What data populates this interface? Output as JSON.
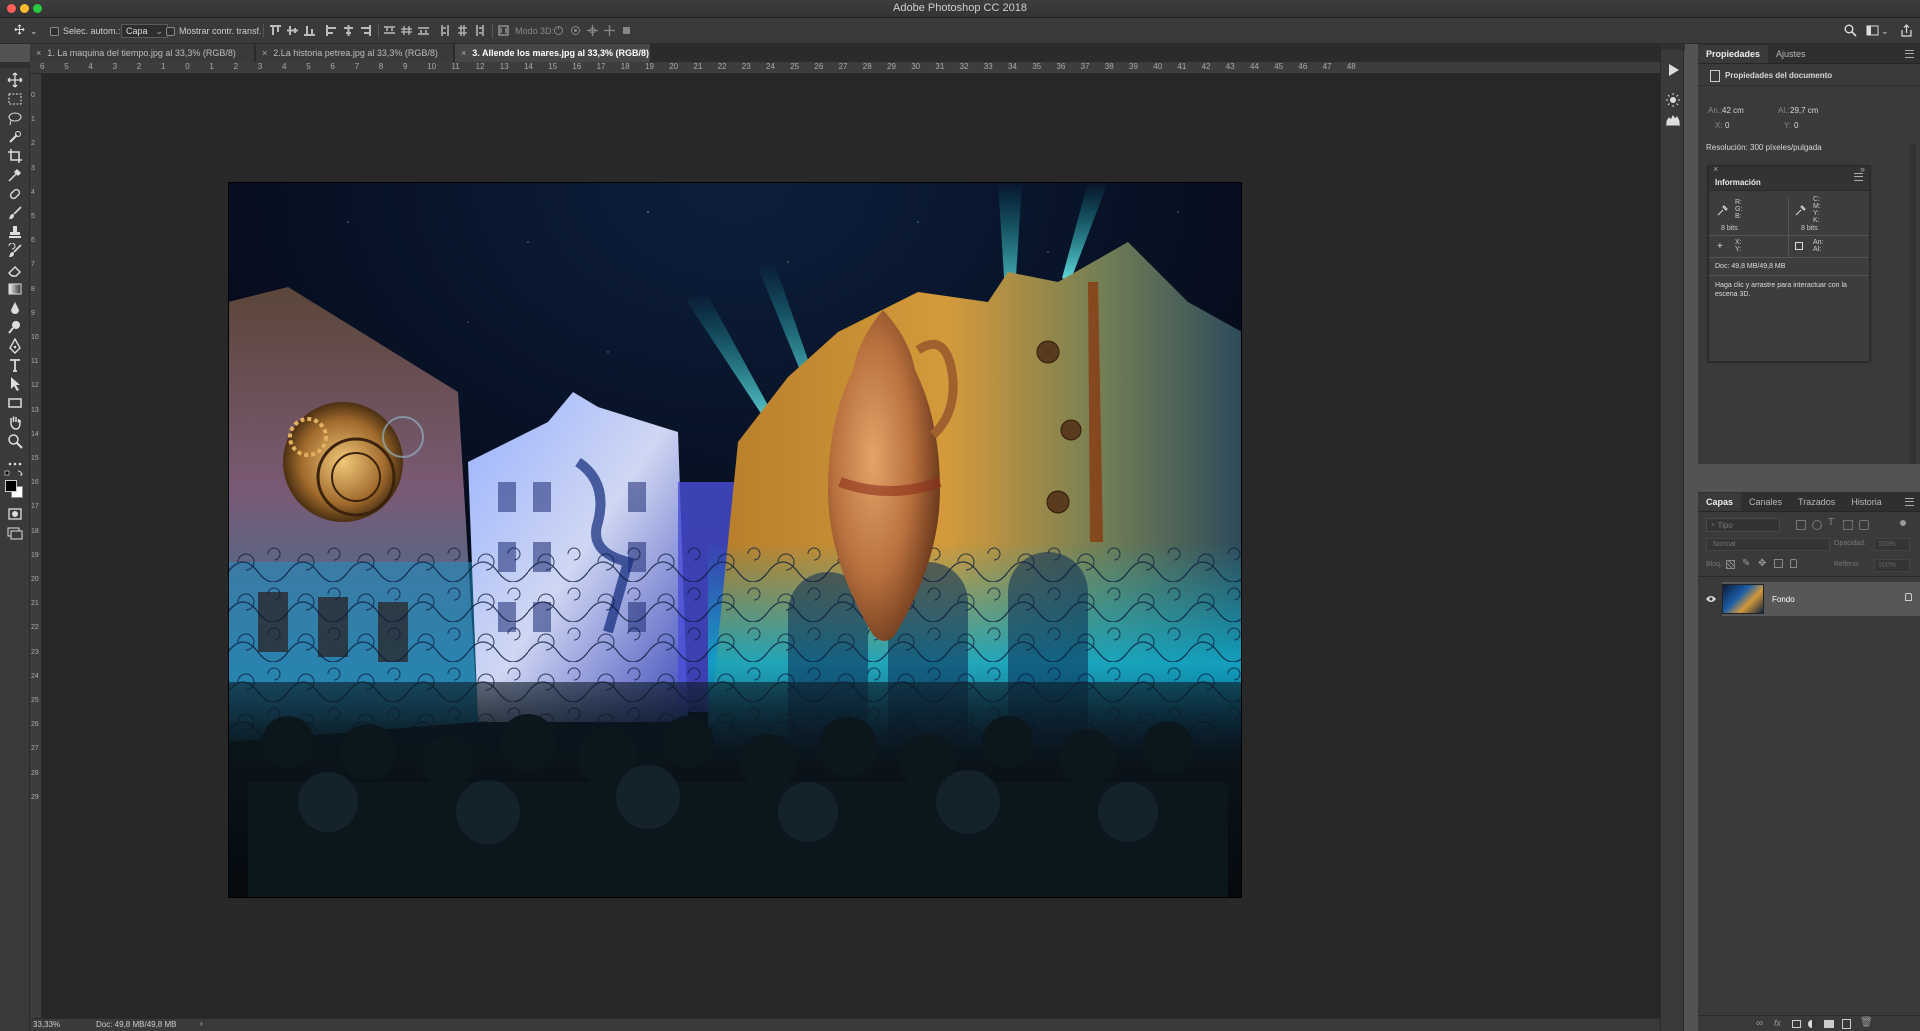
{
  "app": {
    "window_title": "Adobe Photoshop CC 2018"
  },
  "options_bar": {
    "auto_select_label": "Selec. autom.:",
    "auto_select_target": "Capa",
    "show_transform_label": "Mostrar contr. transf.",
    "mode_3d_label": "Modo 3D:"
  },
  "tabs": [
    {
      "label": "1. La maquina del tiempo.jpg al 33,3% (RGB/8)",
      "active": false
    },
    {
      "label": "2.La historia petrea.jpg al 33,3% (RGB/8)",
      "active": false
    },
    {
      "label": "3. Allende los mares.jpg al 33,3% (RGB/8)",
      "active": true
    }
  ],
  "ruler_top": [
    "6",
    "5",
    "4",
    "3",
    "2",
    "1",
    "0",
    "1",
    "2",
    "3",
    "4",
    "5",
    "6",
    "7",
    "8",
    "9",
    "10",
    "11",
    "12",
    "13",
    "14",
    "15",
    "16",
    "17",
    "18",
    "19",
    "20",
    "21",
    "22",
    "23",
    "24",
    "25",
    "26",
    "27",
    "28",
    "29",
    "30",
    "31",
    "32",
    "33",
    "34",
    "35",
    "36",
    "37",
    "38",
    "39",
    "40",
    "41",
    "42",
    "43",
    "44",
    "45",
    "46",
    "47",
    "48"
  ],
  "ruler_left": [
    "0",
    "1",
    "2",
    "3",
    "4",
    "5",
    "6",
    "7",
    "8",
    "9",
    "10",
    "11",
    "12",
    "13",
    "14",
    "15",
    "16",
    "17",
    "18",
    "19",
    "20",
    "21",
    "22",
    "23",
    "24",
    "25",
    "26",
    "27",
    "28",
    "29"
  ],
  "status": {
    "zoom": "33,33%",
    "doc": "Doc: 49,8 MB/49,8 MB",
    "arrow": "›"
  },
  "properties_panel": {
    "tabs": [
      "Propiedades",
      "Ajustes"
    ],
    "section_title": "Propiedades del documento",
    "width_label": "An.:",
    "width_value": "42 cm",
    "height_label": "Al.:",
    "height_value": "29,7 cm",
    "x_label": "X:",
    "x_value": "0",
    "y_label": "Y:",
    "y_value": "0",
    "resolution": "Resolución: 300 píxeles/pulgada"
  },
  "info_panel": {
    "tab": "Información",
    "rgb_labels": [
      "R:",
      "G:",
      "B:"
    ],
    "cmyk_labels": [
      "C:",
      "M:",
      "Y:",
      "K:"
    ],
    "bits_left": "8 bits",
    "bits_right": "8 bits",
    "xy_labels": [
      "X:",
      "Y:"
    ],
    "size_labels": [
      "An:",
      "Al:"
    ],
    "doc": "Doc: 49,8 MB/49,8 MB",
    "hint": "Haga clic y arrastre para interactuar con la escena 3D."
  },
  "layers_panel": {
    "tabs": [
      "Capas",
      "Canales",
      "Trazados",
      "Historia"
    ],
    "filter_placeholder": "Tipo",
    "blend_mode": "Normal",
    "opacity_label": "Opacidad:",
    "opacity_value": "100%",
    "lock_label": "Bloq.:",
    "fill_label": "Relleno:",
    "fill_value": "100%",
    "layers": [
      {
        "name": "Fondo",
        "visible": true,
        "locked": true
      }
    ]
  },
  "colors": {
    "chrome_dark": "#2b2b2b",
    "chrome_mid": "#3a3a3a",
    "pasteboard": "#282828",
    "layer_selected": "#575757"
  }
}
